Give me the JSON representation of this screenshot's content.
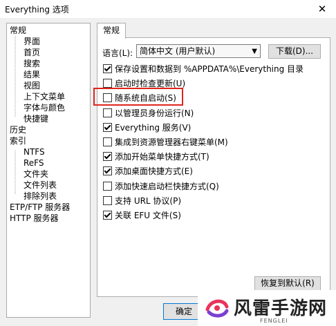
{
  "window": {
    "title": "Everything 选项",
    "close_label": "✕"
  },
  "tree": {
    "items": [
      {
        "label": "常规",
        "level": 0
      },
      {
        "label": "界面",
        "level": 1
      },
      {
        "label": "首页",
        "level": 1
      },
      {
        "label": "搜索",
        "level": 1
      },
      {
        "label": "结果",
        "level": 1
      },
      {
        "label": "视图",
        "level": 1
      },
      {
        "label": "上下文菜单",
        "level": 1
      },
      {
        "label": "字体与颜色",
        "level": 1
      },
      {
        "label": "快捷键",
        "level": 1
      },
      {
        "label": "历史",
        "level": 0
      },
      {
        "label": "索引",
        "level": 0
      },
      {
        "label": "NTFS",
        "level": 1
      },
      {
        "label": "ReFS",
        "level": 1
      },
      {
        "label": "文件夹",
        "level": 1
      },
      {
        "label": "文件列表",
        "level": 1
      },
      {
        "label": "排除列表",
        "level": 1
      },
      {
        "label": "ETP/FTP 服务器",
        "level": 0
      },
      {
        "label": "HTTP 服务器",
        "level": 0
      }
    ]
  },
  "tab": {
    "label": "常规"
  },
  "language": {
    "label": "语言(L):",
    "value": "简体中文 (用户默认)",
    "download_label": "下载(D)..."
  },
  "options": [
    {
      "label": "保存设置和数据到 %APPDATA%\\Everything 目录",
      "checked": true
    },
    {
      "label": "启动时检查更新(U)",
      "checked": false
    },
    {
      "label": "随系统自启动(S)",
      "checked": false
    },
    {
      "label": "以管理员身份运行(N)",
      "checked": false
    },
    {
      "label": "Everything 服务(V)",
      "checked": true
    },
    {
      "label": "集成到资源管理器右键菜单(M)",
      "checked": false
    },
    {
      "label": "添加开始菜单快捷方式(T)",
      "checked": true
    },
    {
      "label": "添加桌面快捷方式(E)",
      "checked": true
    },
    {
      "label": "添加快速启动栏快捷方式(Q)",
      "checked": false
    },
    {
      "label": "支持 URL 协议(P)",
      "checked": false
    },
    {
      "label": "关联 EFU 文件(S)",
      "checked": true
    }
  ],
  "buttons": {
    "restore_label": "恢复到默认(R)",
    "ok_label": "确定"
  },
  "watermark": {
    "text": "风雷手游网",
    "sub": "FENGLEI"
  },
  "colors": {
    "highlight": "#e0241b",
    "panel_bg": "#ffffff",
    "window_bg": "#f0f0f0"
  }
}
